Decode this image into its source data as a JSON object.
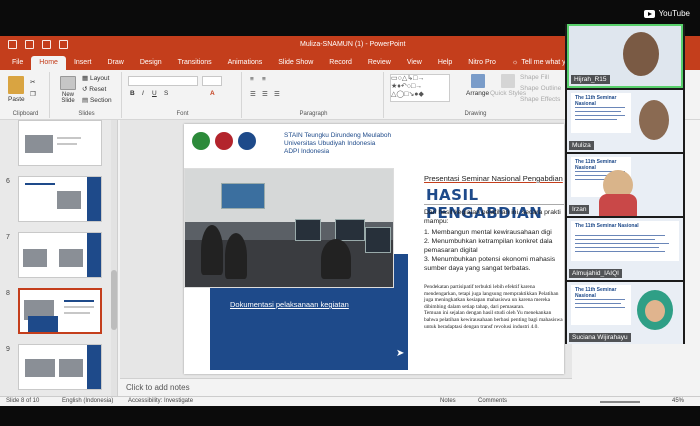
{
  "youtube": {
    "label": "YouTube"
  },
  "ppt": {
    "window_title": "Muliza-SNAMUN (1) - PowerPoint",
    "tabs": [
      "File",
      "Home",
      "Insert",
      "Draw",
      "Design",
      "Transitions",
      "Animations",
      "Slide Show",
      "Record",
      "Review",
      "View",
      "Help",
      "Nitro Pro"
    ],
    "active_tab": "Home",
    "tell_me": "Tell me what you want to do",
    "ribbon": {
      "clipboard": "Clipboard",
      "paste": "Paste",
      "slides": "Slides",
      "new_slide": "New Slide",
      "layout": "Layout",
      "reset": "Reset",
      "section": "Section",
      "font": "Font",
      "paragraph": "Paragraph",
      "drawing": "Drawing",
      "arrange": "Arrange",
      "quick_styles": "Quick Styles",
      "shape_fill": "Shape Fill",
      "shape_outline": "Shape Outline",
      "shape_effects": "Shape Effects"
    },
    "thumbnails": [
      {
        "num": "",
        "selected": false
      },
      {
        "num": "6",
        "selected": false
      },
      {
        "num": "7",
        "selected": false
      },
      {
        "num": "8",
        "selected": true
      },
      {
        "num": "9",
        "selected": false
      }
    ],
    "notes_placeholder": "Click to add notes",
    "status": {
      "slide": "Slide 8 of 10",
      "language": "English (Indonesia)",
      "accessibility": "Accessibility: Investigate",
      "notes": "Notes",
      "comments": "Comments",
      "zoom": "45%"
    }
  },
  "slide": {
    "inst_line1": "STAIN Teungku Dirundeng Meulaboh",
    "inst_line2": "Universitas Ubudiyah Indonesia",
    "inst_line3": "ADPI Indonesia",
    "subtitle": "Presentasi Seminar Nasional Pengabdian",
    "heading": "HASIL PENGABDIAN",
    "intro": "Dari hasil kegiatan pelatihan ini, secara prakti mampu:",
    "items": [
      "1.  Membangun mental kewirausahaan digi",
      "2.  Menumbuhkan ketrampilan konkret dala pemasaran digital",
      "3.  Menumbuhkan potensi ekonomi mahasis sumber daya yang sangat terbatas."
    ],
    "body1": "Pendekatan partisipatif terbukti lebih efektif karena mendengarkan, tetapi juga langsung mempraktikkan Pelatihan juga meningkatkan kesiapan mahasiswa un karena mereka dibimbing dalam setiap tahap, dari pemasaran.",
    "body2": "Temuan ini sejalan dengan hasil studi oleh Yu menekankan bahwa pelatihan kewirausahaan berbasi penting bagi mahasiswa untuk beradaptasi dengan transf revolusi industri 4.0.",
    "caption": "Dokumentasi pelaksanaan kegiatan"
  },
  "participants": [
    {
      "name": "Hijrah_R15",
      "active": true
    },
    {
      "name": "Muliza",
      "active": false
    },
    {
      "name": "Irzan",
      "active": false
    },
    {
      "name": "Almujahid_IAIQI",
      "active": false
    },
    {
      "name": "Suciana Wijirahayu",
      "active": false
    }
  ],
  "banner_text": "The 11th Seminar Nasional",
  "colors": {
    "ppt_red": "#c43e1c",
    "slide_blue": "#1e4a8a",
    "active_speaker": "#58d06b"
  }
}
